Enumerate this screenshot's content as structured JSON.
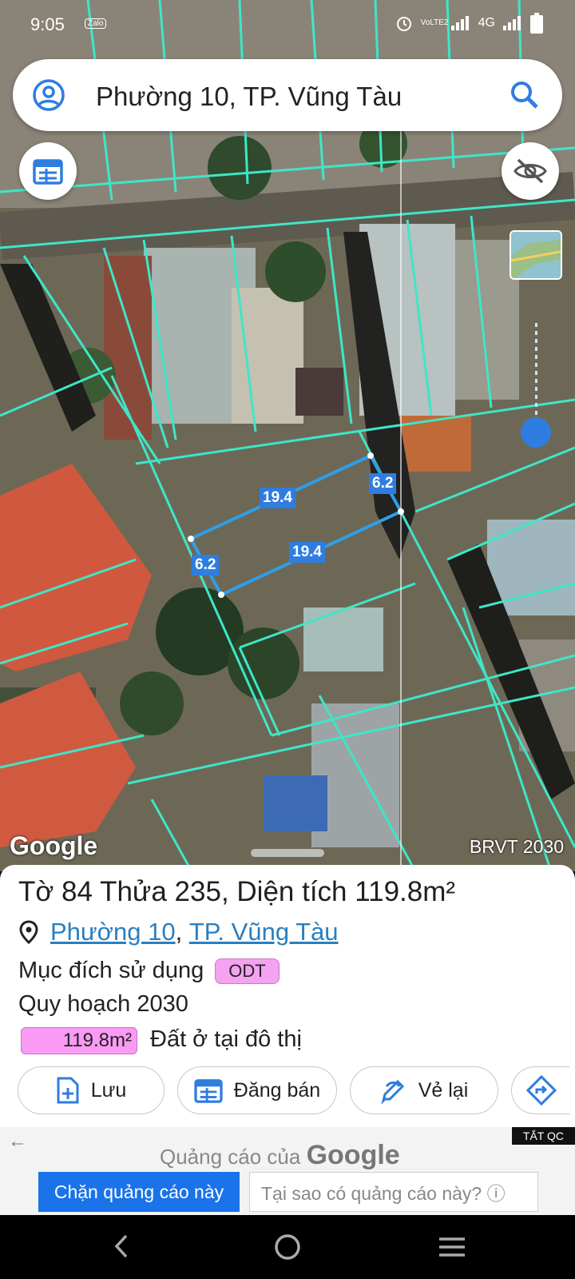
{
  "status_bar": {
    "time": "9:05",
    "notification": "Zalo",
    "volte": "VoLTE2",
    "network": "4G"
  },
  "search": {
    "query": "Phường 10, TP. Vũng Tàu"
  },
  "measurements": {
    "top_length": "19.4",
    "bottom_length": "19.4",
    "left_width": "6.2",
    "right_width": "6.2"
  },
  "map_overlay": {
    "google": "Google",
    "layer_name": "BRVT 2030"
  },
  "parcel": {
    "title": "Tờ 84 Thửa 235, Diện tích 119.8m²",
    "ward": "Phường 10",
    "separator": ", ",
    "city": "TP. Vũng Tàu",
    "usage_label": "Mục đích sử dụng",
    "usage_code": "ODT",
    "plan_label": "Quy hoạch 2030",
    "plan_area": "119.8m²",
    "plan_desc": "Đất ở tại đô thị",
    "plan_color": "#f99bf4"
  },
  "actions": {
    "save": "Lưu",
    "sell": "Đăng bán",
    "redraw": "Vẻ lại"
  },
  "ad": {
    "label": "Quảng cáo của",
    "brand": "Google",
    "close": "TẮT QC",
    "block": "Chặn quảng cáo này",
    "why": "Tại sao có quảng cáo này? ⓘ"
  },
  "colors": {
    "parcel_lines": "#3ee6c8",
    "accent": "#2f7de0",
    "link": "#2a7fc0"
  }
}
